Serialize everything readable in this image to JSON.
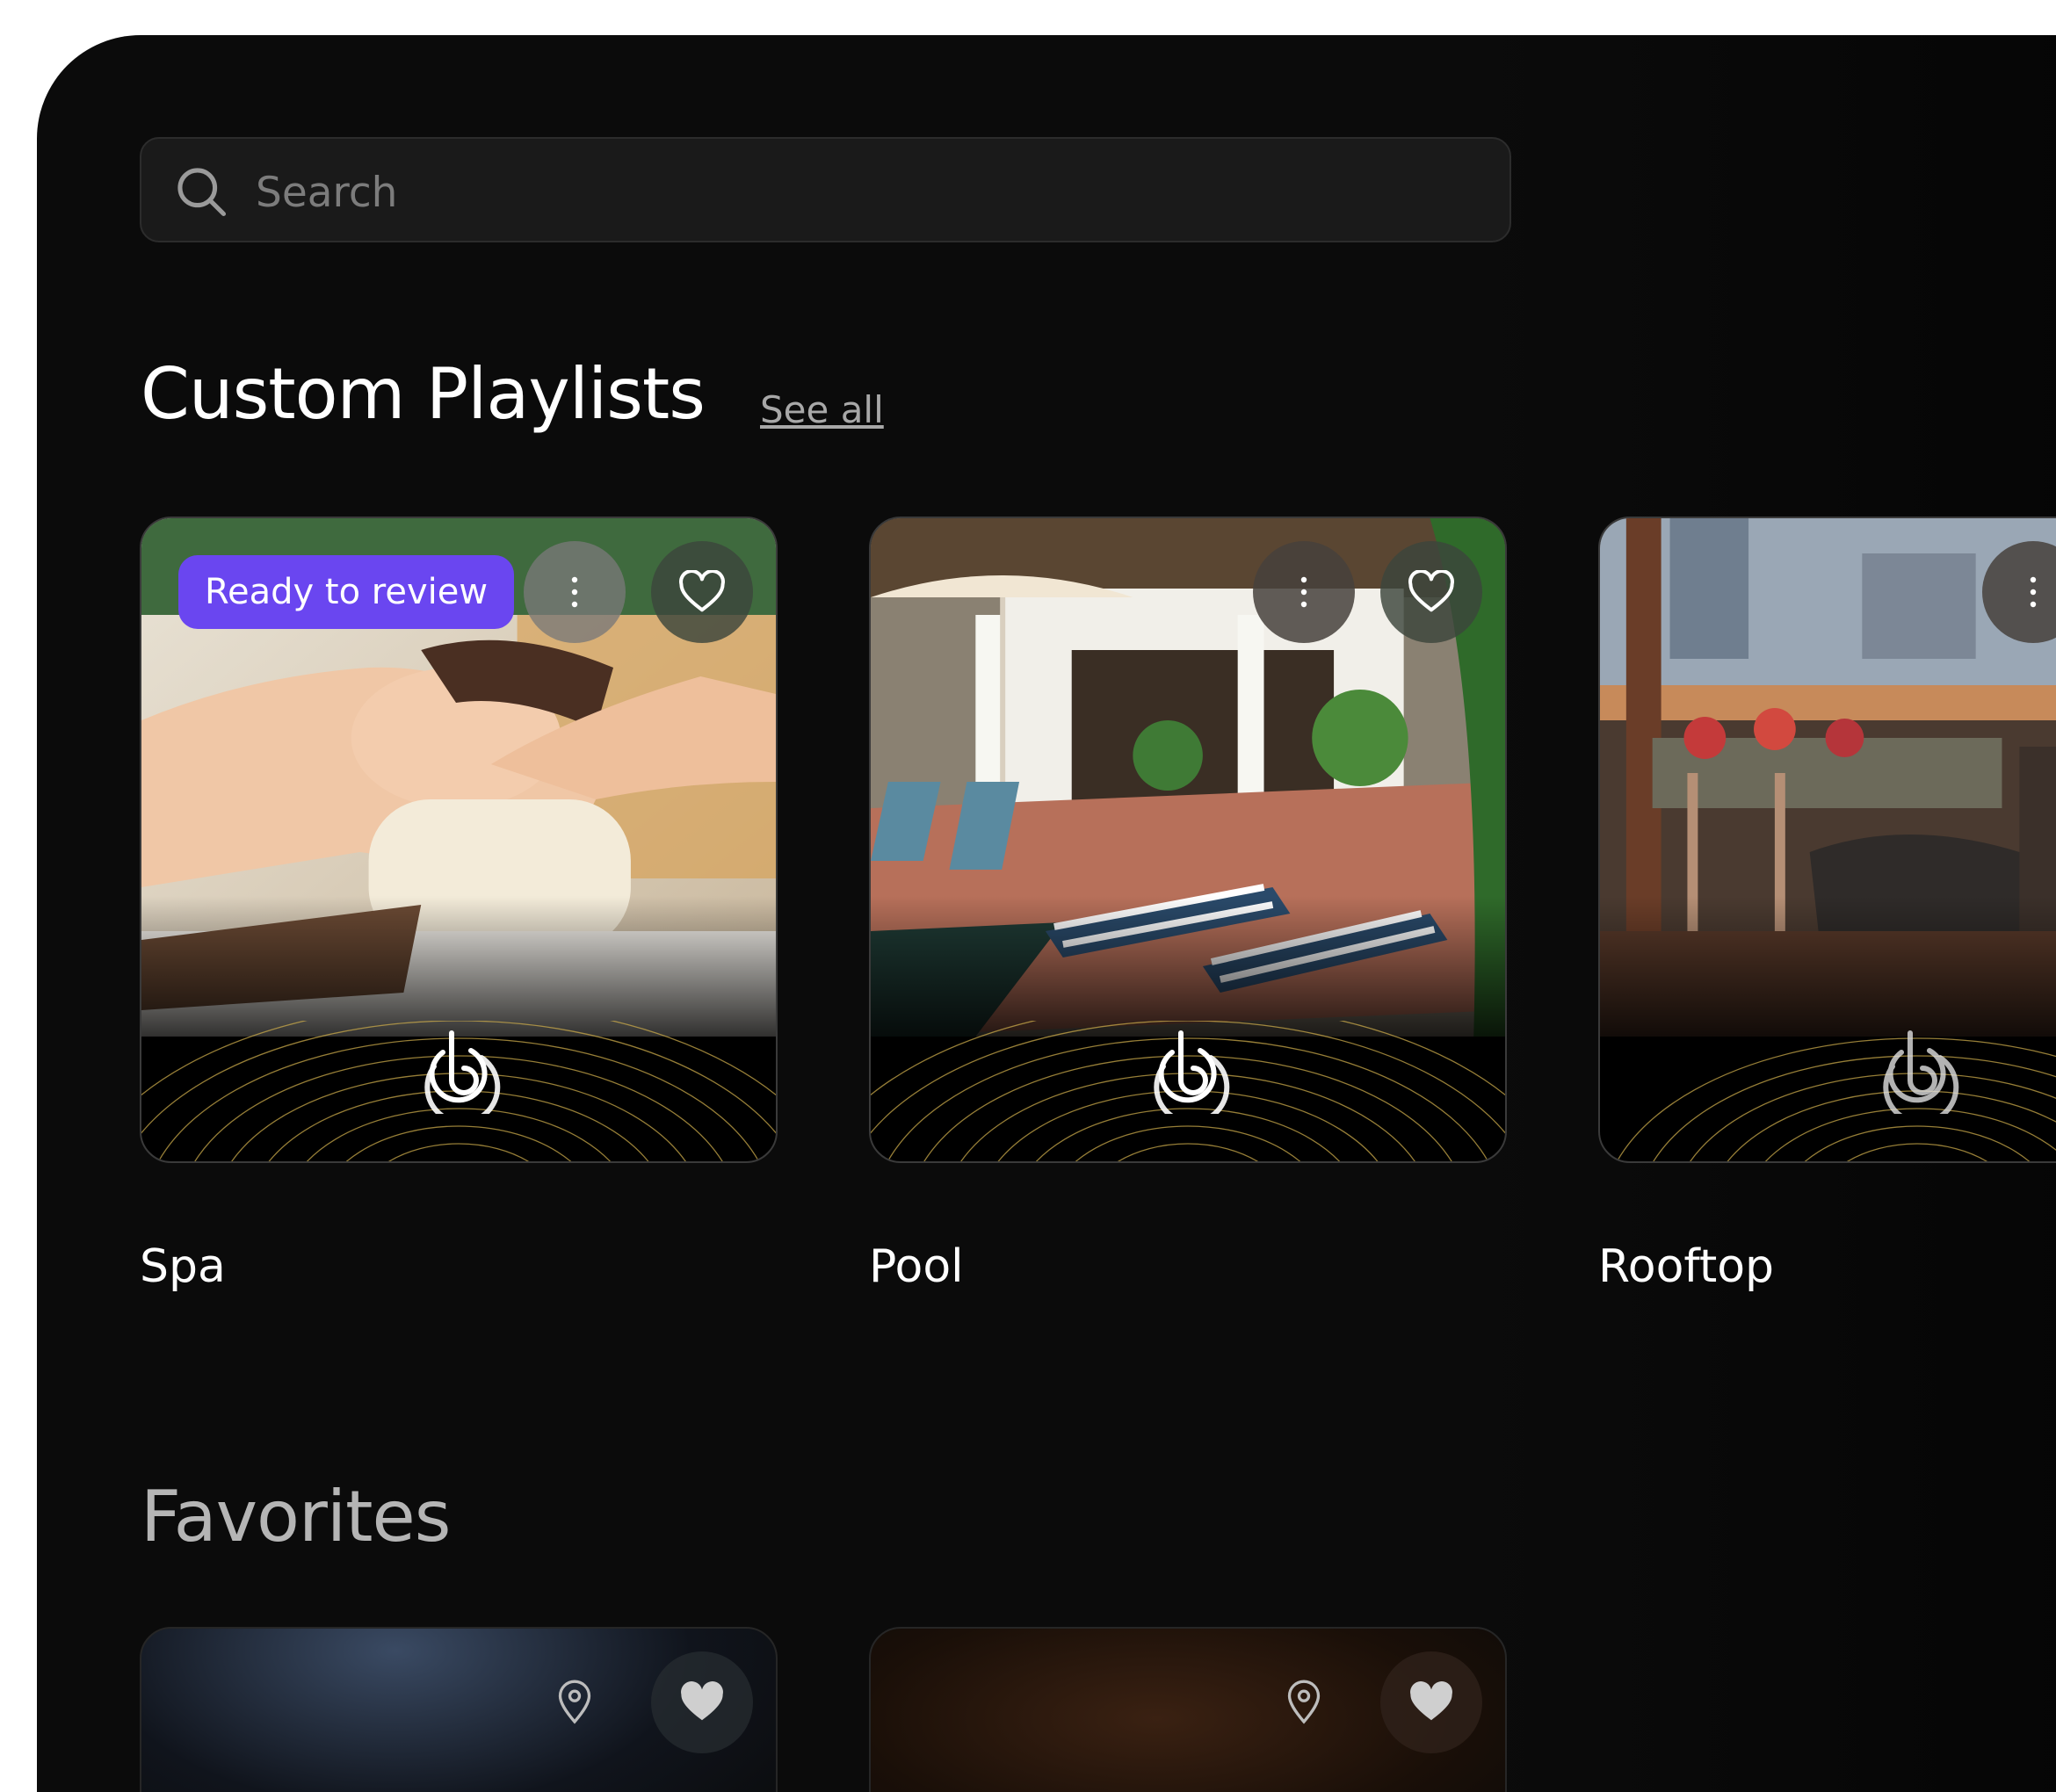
{
  "search": {
    "placeholder": "Search",
    "value": ""
  },
  "custom_playlists": {
    "title": "Custom Playlists",
    "see_all_label": "See all",
    "cards": [
      {
        "label": "Spa",
        "badge": "Ready to review",
        "more_icon": "more-vertical-icon",
        "favorite_icon": "heart-outline-icon"
      },
      {
        "label": "Pool",
        "more_icon": "more-vertical-icon",
        "favorite_icon": "heart-outline-icon"
      },
      {
        "label": "Rooftop",
        "more_icon": "more-vertical-icon"
      }
    ]
  },
  "favorites": {
    "title": "Favorites",
    "cards": [
      {
        "location_icon": "map-pin-icon",
        "favorite_icon": "heart-filled-icon"
      },
      {
        "location_icon": "map-pin-icon",
        "favorite_icon": "heart-filled-icon"
      }
    ]
  },
  "colors": {
    "background": "#0b0b0b",
    "badge": "#6a46f0",
    "text": "#ffffff",
    "muted": "#a8a8a8",
    "gold_lines": "#c9a94a"
  }
}
